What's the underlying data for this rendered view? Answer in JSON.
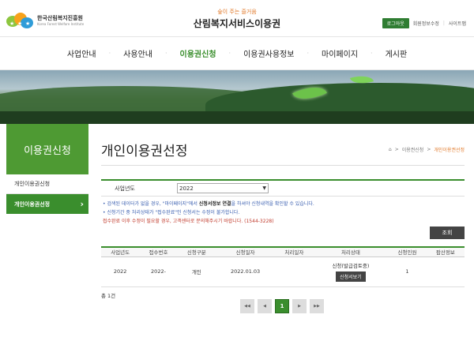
{
  "header": {
    "org_name": "한국산림복지진흥원",
    "org_name_en": "Korea Forest Welfare Institute",
    "tagline": "숲이 주는 즐거움",
    "title": "산림복지서비스이용권",
    "util": {
      "login": "로그아웃",
      "member_info": "회원정보수정",
      "sitemap": "사이트맵"
    }
  },
  "gnb": {
    "items": [
      {
        "label": "사업안내"
      },
      {
        "label": "사용안내"
      },
      {
        "label": "이용권신청"
      },
      {
        "label": "이용권사용정보"
      },
      {
        "label": "마이페이지"
      },
      {
        "label": "게시판"
      }
    ],
    "active_color": "#3a8e2d"
  },
  "lnb": {
    "title": "이용권신청",
    "items": [
      {
        "label": "개인이용권신청"
      },
      {
        "label": "개인이용권선정"
      }
    ],
    "active_arrow": "›"
  },
  "page": {
    "title": "개인이용권선정",
    "breadcrumb": [
      "이용권신청",
      "개인이용권선정"
    ],
    "breadcrumb_sep": ">"
  },
  "filter": {
    "label": "사업년도",
    "value": "2022"
  },
  "notes": {
    "line1_a": "• 검색된 데이터가 없을 경우, \"마이페이지\"에서 ",
    "line1_b": "신청서정보 연결",
    "line1_c": "을 하셔야 신청내역을 확인할 수 있습니다.",
    "line2": "• 신청기간 중 처리상태가 \"접수완료\"인 신청서는 수정이 불가합니다.",
    "line3": "접수완료 이후 수정이 필요할 경우, 고객센터로 문의해주시기 바랍니다. (1544-3228)"
  },
  "search_button": "조회",
  "table": {
    "headers": [
      "사업년도",
      "접수번호",
      "신청구분",
      "신청일자",
      "처리일자",
      "처리상태",
      "신청인원",
      "팝산정보"
    ],
    "rows": [
      {
        "year": "2022",
        "receipt_no": "2022-",
        "type": "개인",
        "apply_date": "2022.01.03",
        "process_date": "",
        "status": "신청(발급검토중)",
        "detail_button": "신청서보기",
        "count": "1",
        "extra": ""
      }
    ]
  },
  "total": "총 1건",
  "pager": {
    "first": "◀◀",
    "prev": "◀",
    "current": "1",
    "next": "▶",
    "last": "▶▶"
  },
  "colors": {
    "brand_green": "#3a8e2d",
    "lnb_head": "#4e9a33",
    "accent_orange": "#e17a2b",
    "note_blue": "#3a5fb0",
    "note_red": "#c0392b"
  }
}
